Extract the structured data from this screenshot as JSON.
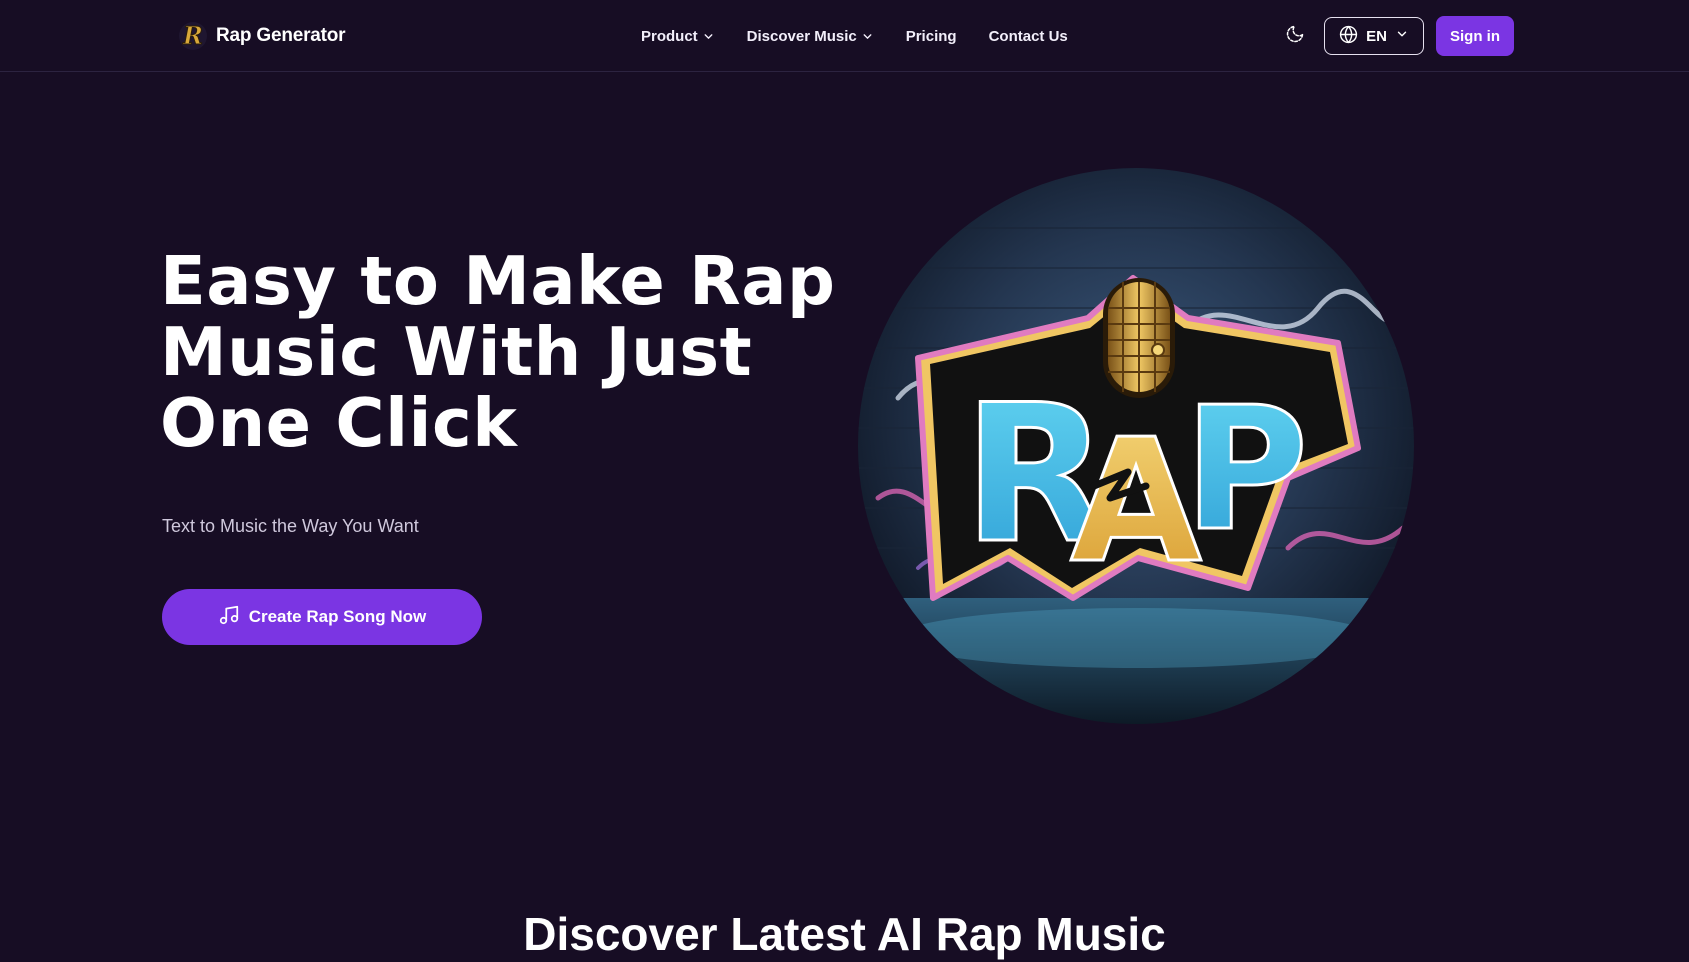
{
  "header": {
    "brand": {
      "name": "Rap Generator",
      "logo_icon": "r-monogram-logo-icon"
    },
    "nav": [
      {
        "label": "Product",
        "has_dropdown": true
      },
      {
        "label": "Discover Music",
        "has_dropdown": true
      },
      {
        "label": "Pricing",
        "has_dropdown": false
      },
      {
        "label": "Contact Us",
        "has_dropdown": false
      }
    ],
    "theme_toggle_icon": "moon-icon",
    "language": {
      "selected": "EN",
      "icon": "globe-icon"
    },
    "signin_label": "Sign in"
  },
  "hero": {
    "title_lines": [
      "Easy to Make Rap",
      "Music With Just",
      "One Click"
    ],
    "subtitle": "Text to Music the Way You Want",
    "cta_label": "Create Rap Song Now",
    "cta_icon": "music-note-icon",
    "image_text": "RAP"
  },
  "section": {
    "title": "Discover Latest AI Rap Music"
  },
  "colors": {
    "background": "#170d24",
    "accent": "#7b35e3",
    "text": "#ffffff",
    "muted_text": "#cfc8dc"
  }
}
